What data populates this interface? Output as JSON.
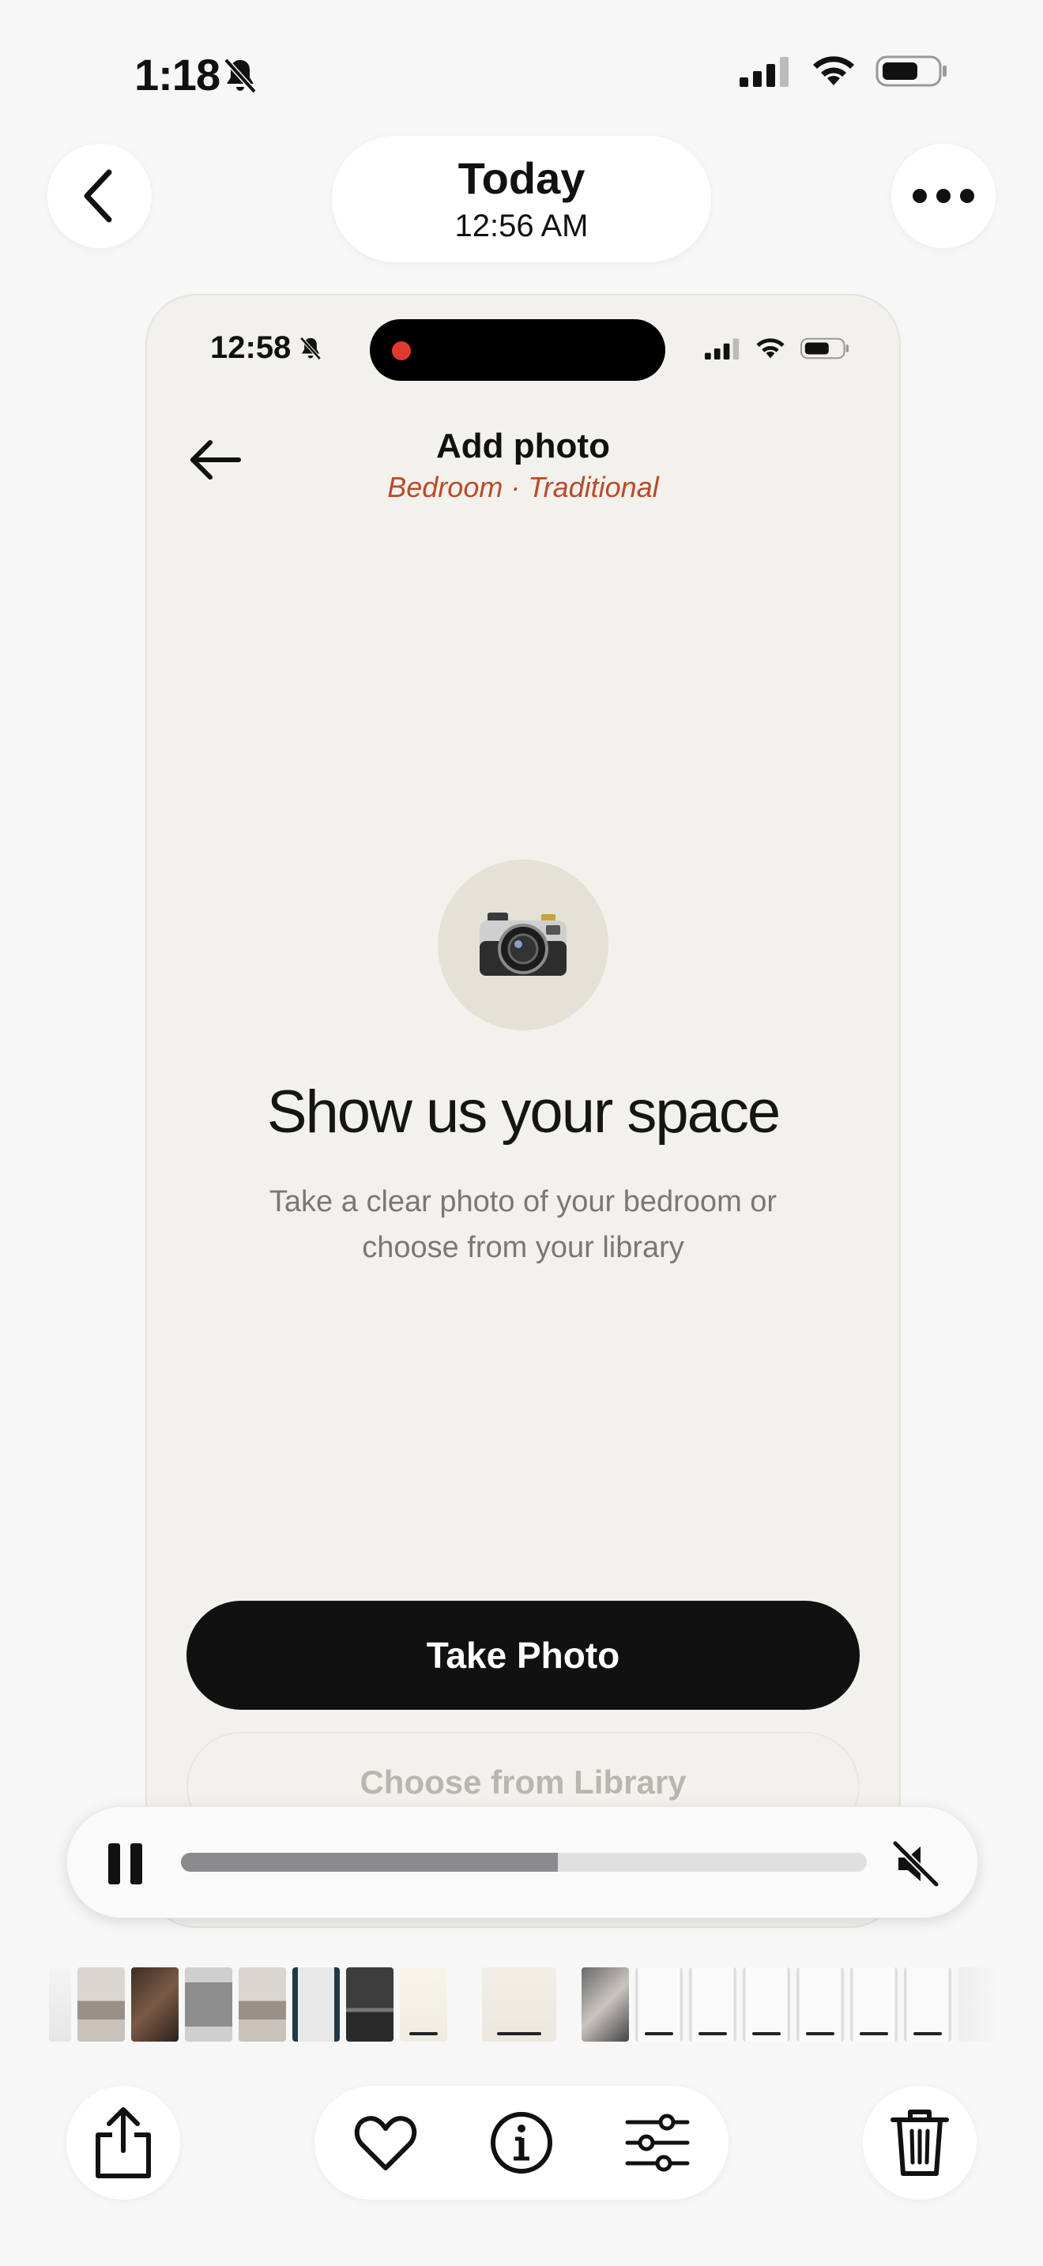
{
  "status_bar": {
    "time": "1:18"
  },
  "nav": {
    "date_title": "Today",
    "date_time": "12:56 AM"
  },
  "phone": {
    "status_time": "12:58",
    "header": {
      "title": "Add photo",
      "subtitle": "Bedroom · Traditional"
    },
    "camera_emoji": "📷",
    "headline": "Show us your space",
    "description": "Take a clear photo of your bedroom or choose from your library",
    "take_photo_label": "Take Photo",
    "library_label": "Choose from Library"
  },
  "playback": {
    "progress": 0.55,
    "paused": false,
    "muted": true
  },
  "thumbnails": [
    {
      "kind": "light"
    },
    {
      "kind": "room"
    },
    {
      "kind": "dark-room"
    },
    {
      "kind": "room-framed"
    },
    {
      "kind": "room"
    },
    {
      "kind": "phone-dark"
    },
    {
      "kind": "laptop"
    },
    {
      "kind": "app-screen"
    },
    {
      "kind": "app-screen-wide"
    },
    {
      "kind": "collage"
    },
    {
      "kind": "phone"
    },
    {
      "kind": "phone"
    },
    {
      "kind": "phone"
    },
    {
      "kind": "phone"
    },
    {
      "kind": "phone"
    },
    {
      "kind": "phone"
    },
    {
      "kind": "phone-faded"
    }
  ],
  "colors": {
    "accent_subtitle": "#b94a2a",
    "phone_bg": "#f3f1ec",
    "record_dot": "#e03a2f"
  }
}
